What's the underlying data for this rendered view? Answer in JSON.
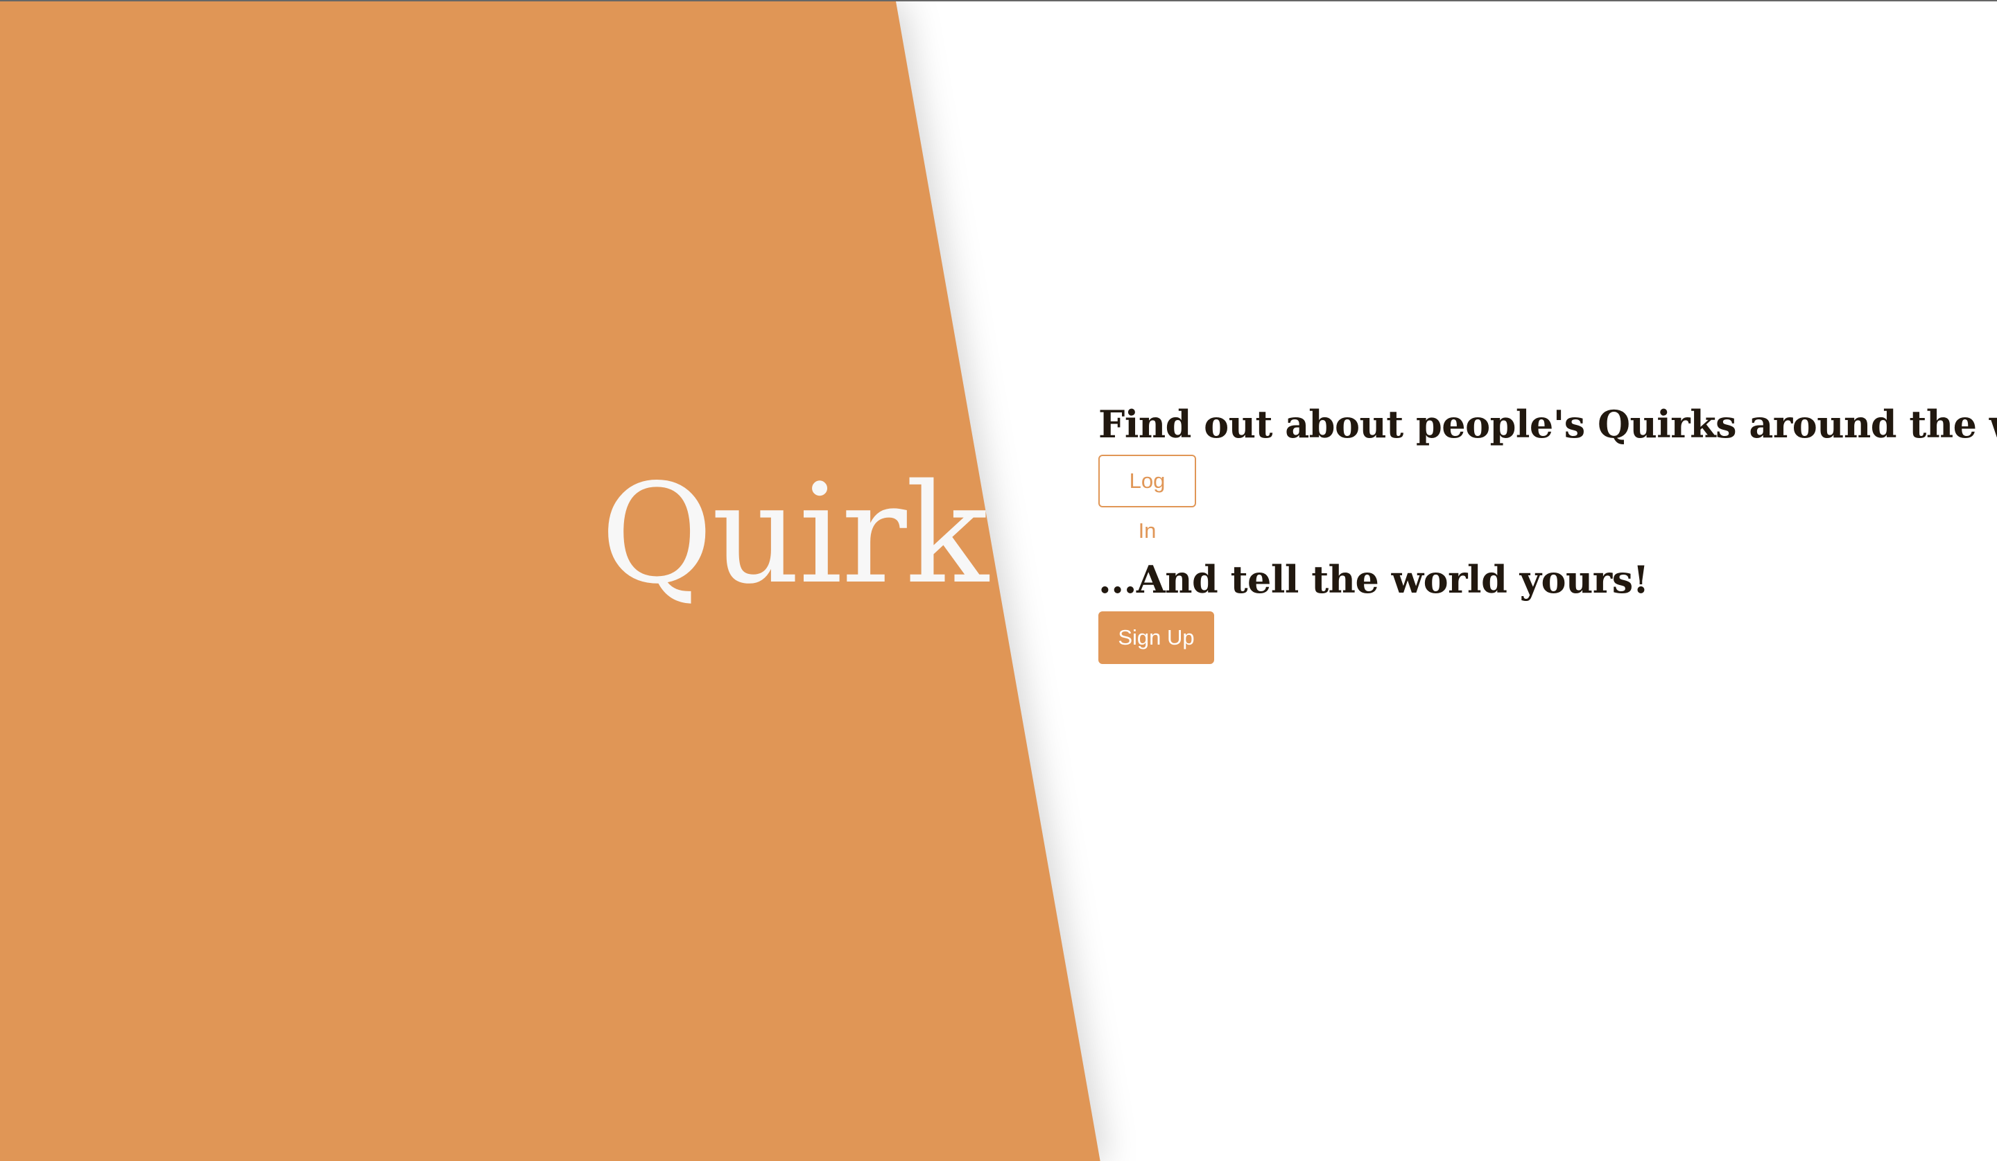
{
  "brand": {
    "name": "Quirk"
  },
  "hero": {
    "headline": "Find out about people's Quirks around the world",
    "login_label": "Log In",
    "secondary_headline": "...And tell the world yours!",
    "signup_label": "Sign Up"
  },
  "colors": {
    "accent": "#e09656",
    "text": "#21180f",
    "background": "#ffffff"
  }
}
